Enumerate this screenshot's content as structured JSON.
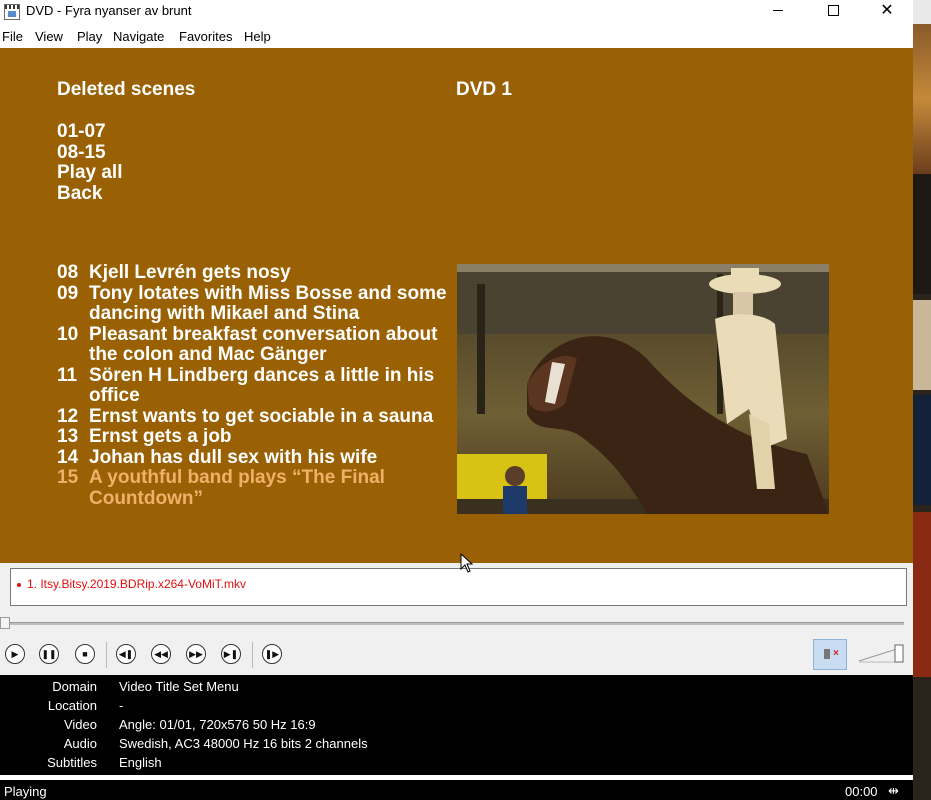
{
  "window": {
    "title": "DVD - Fyra nyanser av brunt",
    "minimize": "",
    "maximize": "",
    "close": "✕"
  },
  "menubar": [
    "File",
    "View",
    "Play",
    "Navigate",
    "Favorites",
    "Help"
  ],
  "dvd_menu": {
    "title": "Deleted scenes",
    "disc": "DVD 1",
    "nav": [
      "01-07",
      "08-15",
      "Play all",
      "Back"
    ],
    "scenes": [
      {
        "num": "08",
        "text": "Kjell Levrén gets nosy"
      },
      {
        "num": "09",
        "text": "Tony lotates with Miss Bosse and some dancing with Mikael and Stina"
      },
      {
        "num": "10",
        "text": "Pleasant breakfast conversation about the colon and Mac Gänger"
      },
      {
        "num": "11",
        "text": "Sören H Lindberg dances a little in his office"
      },
      {
        "num": "12",
        "text": "Ernst wants to get sociable in a sauna"
      },
      {
        "num": "13",
        "text": "Ernst gets a job"
      },
      {
        "num": "14",
        "text": "Johan has dull sex with his wife"
      },
      {
        "num": "15",
        "text": "A youthful band plays “The Final Countdown”"
      }
    ],
    "background_color": "#9a6104",
    "highlight_color": "#f0b06a"
  },
  "playlist": {
    "items": [
      "1. Itsy.Bitsy.2019.BDRip.x264-VoMiT.mkv"
    ]
  },
  "controls": {
    "buttons": [
      "play",
      "pause",
      "stop",
      "previous",
      "rewind",
      "fast-forward",
      "next",
      "frame-step"
    ],
    "icons": {
      "play": "▶",
      "pause": "❚❚",
      "stop": "■",
      "previous": "◀❚",
      "rewind": "◀◀",
      "fast-forward": "▶▶",
      "next": "▶❚",
      "frame-step": "❚▶"
    },
    "muted": true,
    "seek_position": 0
  },
  "info": [
    {
      "label": "Domain",
      "value": "Video Title Set Menu"
    },
    {
      "label": "Location",
      "value": "-"
    },
    {
      "label": "Video",
      "value": "Angle: 01/01, 720x576 50 Hz 16:9"
    },
    {
      "label": "Audio",
      "value": "Swedish, AC3 48000 Hz 16 bits 2 channels"
    },
    {
      "label": "Subtitles",
      "value": "English"
    }
  ],
  "status": {
    "state": "Playing",
    "time": "00:00"
  }
}
